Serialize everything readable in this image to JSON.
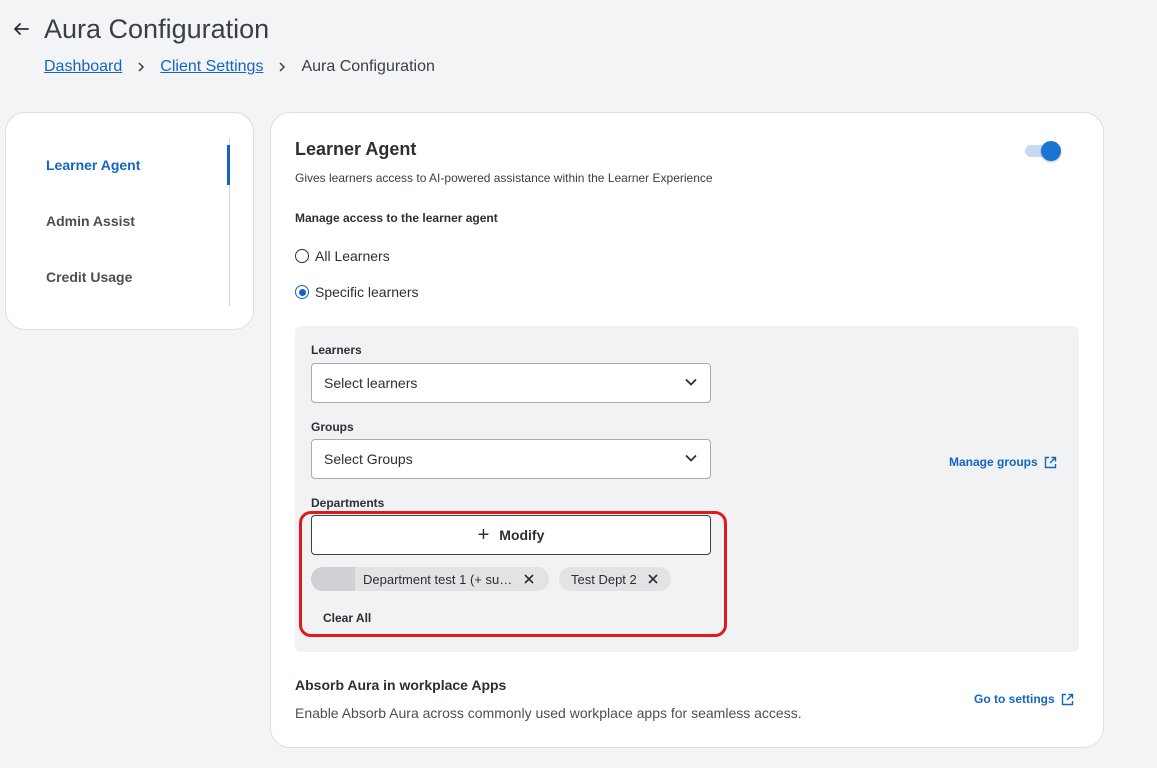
{
  "header": {
    "back_icon": "arrow-left-icon",
    "title": "Aura Configuration",
    "breadcrumb": [
      {
        "label": "Dashboard"
      },
      {
        "label": "Client Settings"
      },
      {
        "label": "Aura Configuration"
      }
    ]
  },
  "sidebar": {
    "items": [
      {
        "label": "Learner Agent",
        "active": true
      },
      {
        "label": "Admin Assist",
        "active": false
      },
      {
        "label": "Credit Usage",
        "active": false
      }
    ]
  },
  "learner_agent": {
    "title": "Learner Agent",
    "description": "Gives learners access to AI-powered assistance within the Learner Experience",
    "enabled": true,
    "access_label": "Manage access to the learner agent",
    "options": [
      {
        "label": "All Learners",
        "selected": false
      },
      {
        "label": "Specific learners",
        "selected": true
      }
    ],
    "learners": {
      "label": "Learners",
      "placeholder": "Select learners"
    },
    "groups": {
      "label": "Groups",
      "placeholder": "Select Groups",
      "manage_link": "Manage groups"
    },
    "departments": {
      "label": "Departments",
      "modify_label": "Modify",
      "chips": [
        {
          "label": "Department test 1 (+ su…"
        },
        {
          "label": "Test Dept 2"
        }
      ],
      "clear_all": "Clear All"
    }
  },
  "workplace_apps": {
    "title": "Absorb Aura in workplace Apps",
    "description": "Enable Absorb Aura across commonly used workplace apps for seamless access.",
    "link": "Go to settings"
  },
  "colors": {
    "accent": "#1565c0",
    "highlight": "#e01919",
    "background": "#f3f4f6"
  }
}
